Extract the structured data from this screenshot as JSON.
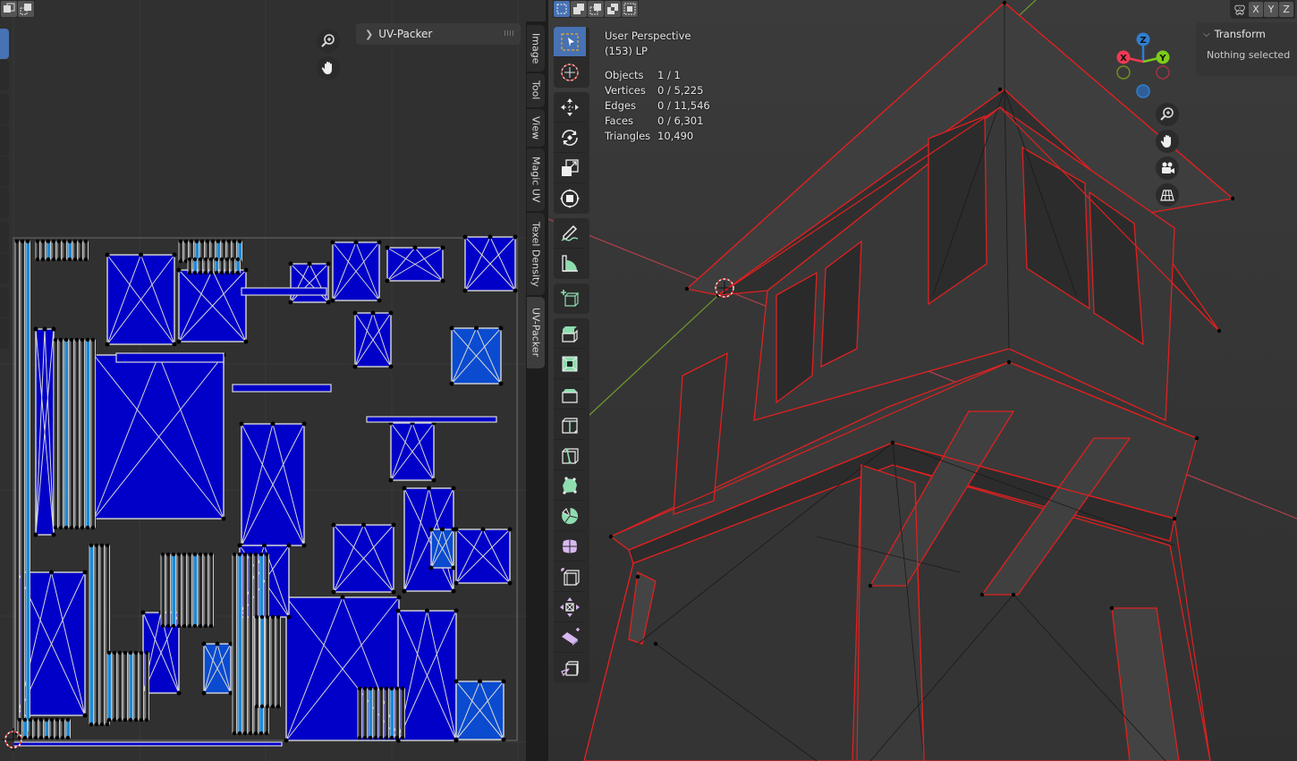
{
  "uv_editor": {
    "header_buttons": [
      {
        "name": "uv-sync-mode-icon"
      },
      {
        "name": "uv-select-island-icon"
      }
    ],
    "navigation": [
      {
        "name": "zoom-icon",
        "tooltip": "Zoom"
      },
      {
        "name": "pan-hand-icon",
        "tooltip": "Pan"
      }
    ],
    "collapsed_panel": {
      "label": "UV-Packer",
      "expanded": false
    },
    "side_tabs": [
      {
        "label": "Image",
        "active": false
      },
      {
        "label": "Tool",
        "active": false
      },
      {
        "label": "View",
        "active": false
      },
      {
        "label": "Magic UV",
        "active": false
      },
      {
        "label": "Texel Density",
        "active": false
      },
      {
        "label": "UV-Packer",
        "active": true
      }
    ],
    "colors": {
      "island_fill": "#0000c8",
      "island_fill_light": "#1a8ad6",
      "edge": "#d8d8d8",
      "vertex": "#000000",
      "bounds": "#6a6a6a"
    }
  },
  "viewport": {
    "select_mode_buttons": [
      {
        "name": "select-new-icon",
        "active": true
      },
      {
        "name": "select-extend-icon",
        "active": false
      },
      {
        "name": "select-subtract-icon",
        "active": false
      },
      {
        "name": "select-difference-icon",
        "active": false
      },
      {
        "name": "select-intersect-icon",
        "active": false
      }
    ],
    "overlay": {
      "view_name": "User Perspective",
      "object_info": "(153) LP",
      "stats": [
        {
          "label": "Objects",
          "value": "1 / 1"
        },
        {
          "label": "Vertices",
          "value": "0 / 5,225"
        },
        {
          "label": "Edges",
          "value": "0 / 11,546"
        },
        {
          "label": "Faces",
          "value": "0 / 6,301"
        },
        {
          "label": "Triangles",
          "value": "10,490"
        }
      ]
    },
    "tools": [
      [
        {
          "name": "select-box-icon",
          "active": true
        },
        {
          "name": "cursor-icon",
          "active": false
        }
      ],
      [
        {
          "name": "move-icon",
          "active": false
        },
        {
          "name": "rotate-icon",
          "active": false
        },
        {
          "name": "scale-icon",
          "active": false
        },
        {
          "name": "transform-icon",
          "active": false
        }
      ],
      [
        {
          "name": "annotate-icon",
          "active": false
        },
        {
          "name": "measure-icon",
          "active": false
        }
      ],
      [
        {
          "name": "add-cube-icon",
          "active": false
        }
      ],
      [
        {
          "name": "extrude-region-icon",
          "active": false
        },
        {
          "name": "inset-faces-icon",
          "active": false
        },
        {
          "name": "bevel-icon",
          "active": false
        },
        {
          "name": "loop-cut-icon",
          "active": false
        },
        {
          "name": "knife-icon",
          "active": false
        },
        {
          "name": "poly-build-icon",
          "active": false
        },
        {
          "name": "spin-icon",
          "active": false
        },
        {
          "name": "smooth-icon",
          "active": false
        },
        {
          "name": "edge-slide-icon",
          "active": false
        },
        {
          "name": "shrink-fatten-icon",
          "active": false
        },
        {
          "name": "shear-icon",
          "active": false
        },
        {
          "name": "rip-region-icon",
          "active": false
        }
      ]
    ],
    "gizmo": {
      "axes": [
        {
          "label": "X",
          "color": "#ee3a54"
        },
        {
          "label": "Y",
          "color": "#7ccb19"
        },
        {
          "label": "Z",
          "color": "#2f7fd0"
        }
      ]
    },
    "nav_buttons": [
      {
        "name": "zoom-icon"
      },
      {
        "name": "pan-hand-icon"
      },
      {
        "name": "camera-view-icon"
      },
      {
        "name": "ortho-grid-icon"
      }
    ],
    "mirror": {
      "labels": [
        "X",
        "Y",
        "Z"
      ]
    },
    "transform_panel": {
      "title": "Transform",
      "message": "Nothing selected"
    },
    "colors": {
      "background": "#3a3a3a",
      "wire_edge": "#e02020",
      "x_axis": "#b0404c",
      "y_axis": "#6f9a2c",
      "accent": "#4772b3"
    }
  }
}
